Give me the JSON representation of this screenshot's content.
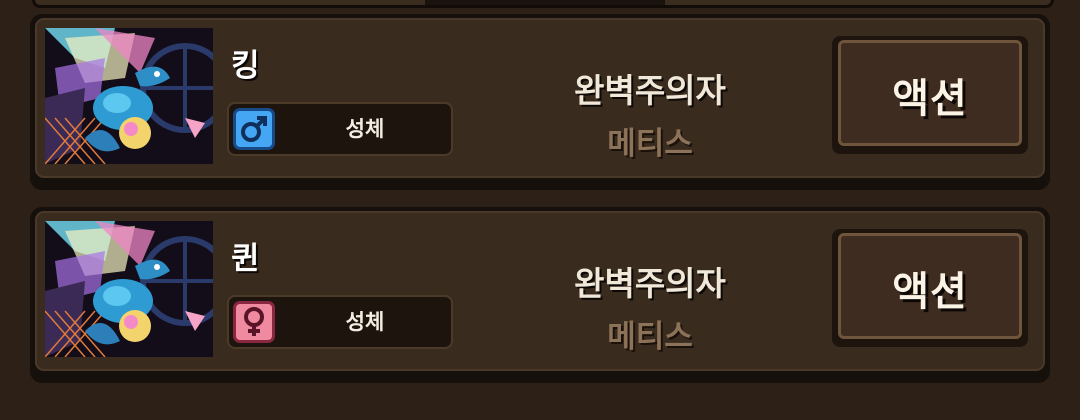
{
  "cards": [
    {
      "name": "킹",
      "gender_icon": "male-symbol-icon",
      "gender_symbol": "♂",
      "gender_color": "#45a6f3",
      "status": "성체",
      "trait_primary": "완벽주의자",
      "trait_secondary": "메티스",
      "action_label": "액션"
    },
    {
      "name": "퀸",
      "gender_icon": "female-symbol-icon",
      "gender_symbol": "♀",
      "gender_color": "#f08aa0",
      "status": "성체",
      "trait_primary": "완벽주의자",
      "trait_secondary": "메티스",
      "action_label": "액션"
    }
  ]
}
